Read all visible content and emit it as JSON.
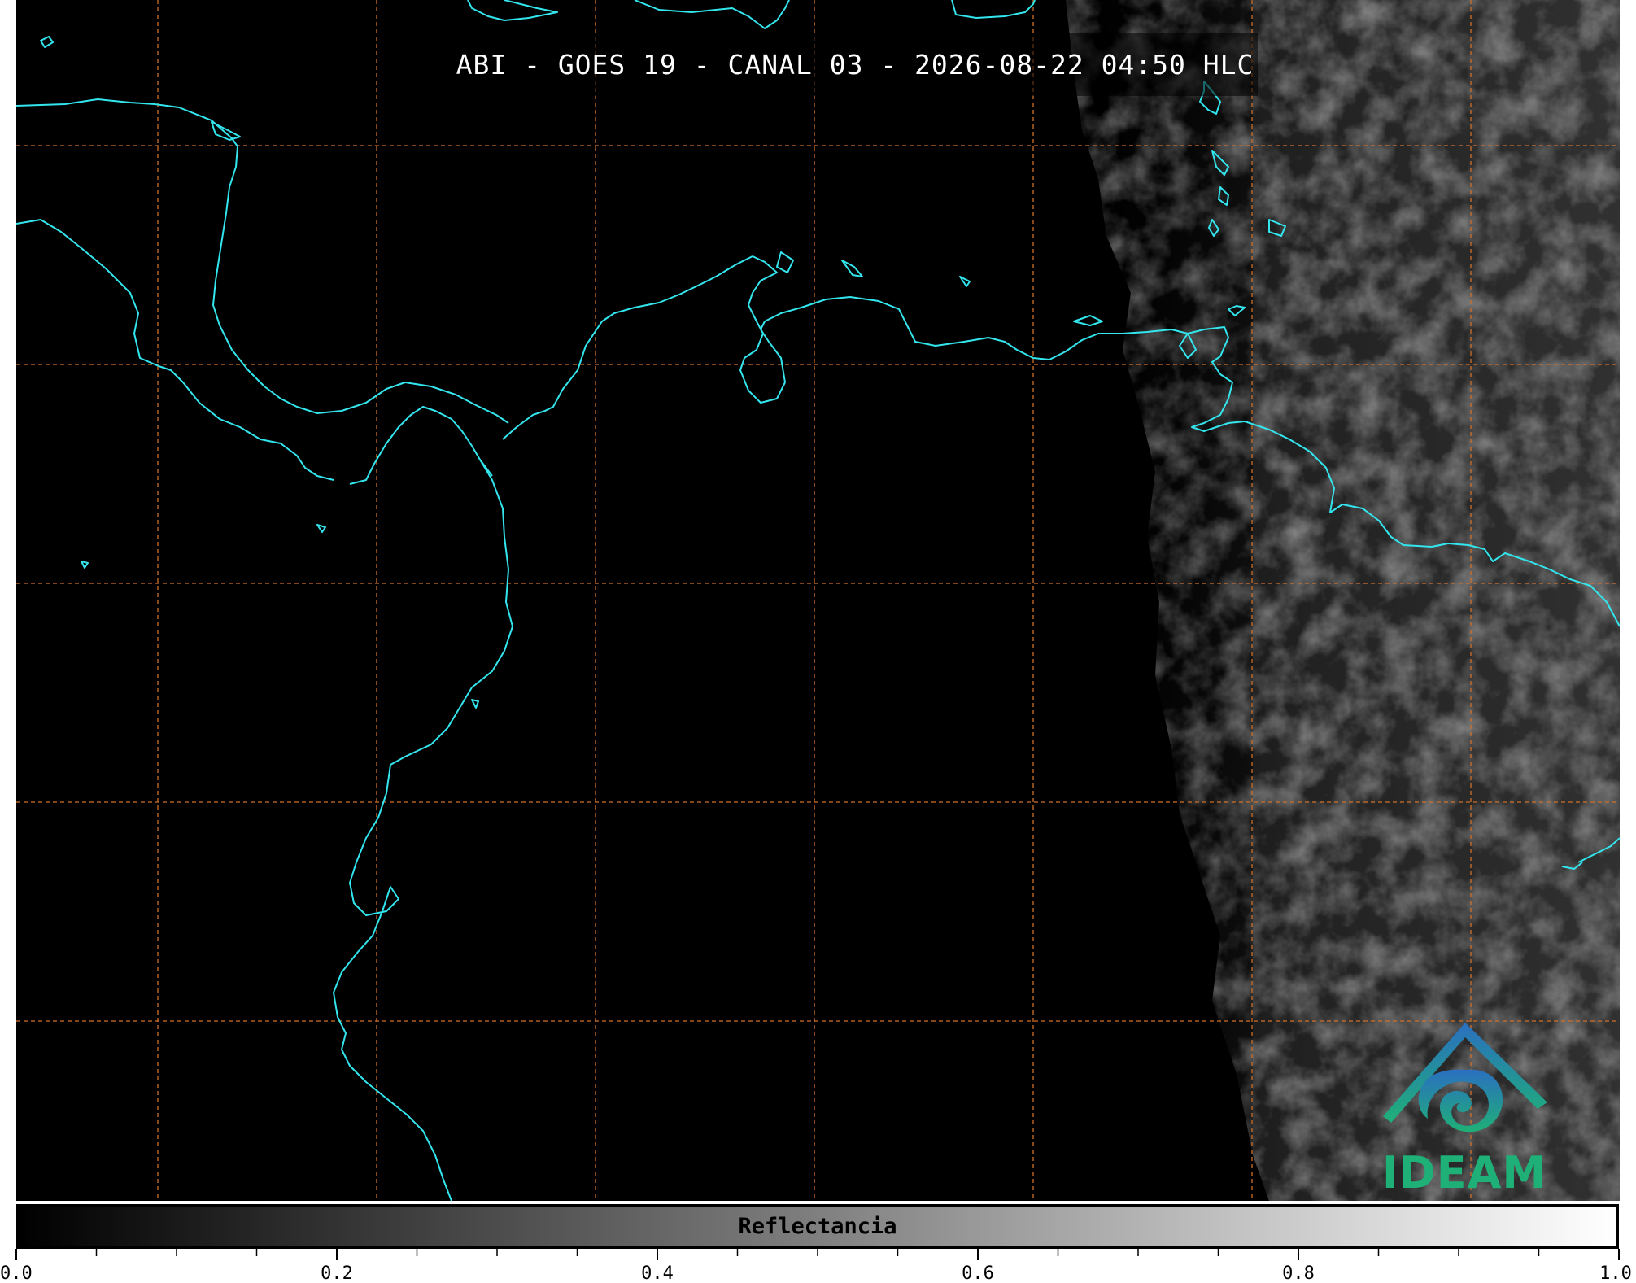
{
  "title": "ABI - GOES 19 - CANAL 03 - 2026-08-22 04:50 HLC",
  "logo": {
    "text": "IDEAM",
    "colors": {
      "roof": "#2a7fb8",
      "swirl": "#1fa98a",
      "text": "#1fb077"
    }
  },
  "map": {
    "background": "#000000",
    "coastline_color": "#33e6ee",
    "grid_color": "#d0702a",
    "grid_style": "dashed",
    "imagery_note": "satellite reflectance (visible channel), clouds over eastern land areas"
  },
  "colorbar": {
    "label": "Reflectancia",
    "min": 0.0,
    "max": 1.0,
    "colormap": "grayscale",
    "tick_labels": [
      "0.0",
      "0.2",
      "0.4",
      "0.6",
      "0.8",
      "1.0"
    ],
    "tick_values": [
      0.0,
      0.2,
      0.4,
      0.6,
      0.8,
      1.0
    ],
    "minor_step": 0.05
  }
}
